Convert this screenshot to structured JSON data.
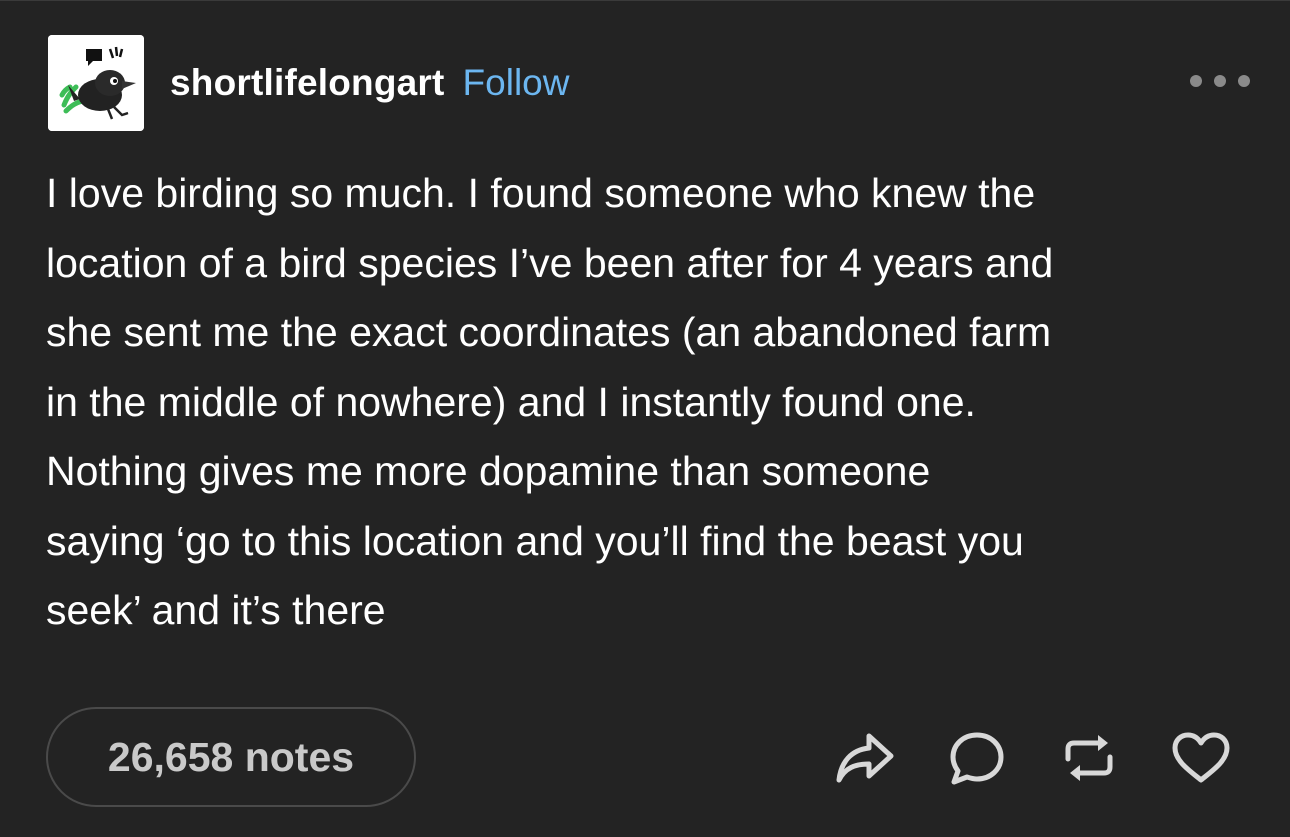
{
  "post": {
    "blog_name": "shortlifelongart",
    "follow_label": "Follow",
    "more_icon": "more-dots-icon",
    "avatar_icon": "crow-avatar-icon",
    "body_lines": [
      "I love birding so much. I found someone who knew the",
      "location of a bird species I’ve been after for 4 years and",
      "she sent me the exact coordinates (an abandoned farm",
      "in the middle of nowhere) and I instantly found one.",
      "Nothing gives me more dopamine than someone",
      "saying ‘go to this location and you’ll find the beast you",
      "seek’ and it’s there"
    ],
    "notes_label": "26,658 notes"
  },
  "actions": [
    {
      "name": "share",
      "icon": "share-arrow-icon"
    },
    {
      "name": "reply",
      "icon": "comment-bubble-icon"
    },
    {
      "name": "reblog",
      "icon": "reblog-icon"
    },
    {
      "name": "like",
      "icon": "heart-icon"
    }
  ],
  "colors": {
    "background": "#232323",
    "text": "#ffffff",
    "follow": "#6cb6f0",
    "muted": "#c9c9c9"
  }
}
